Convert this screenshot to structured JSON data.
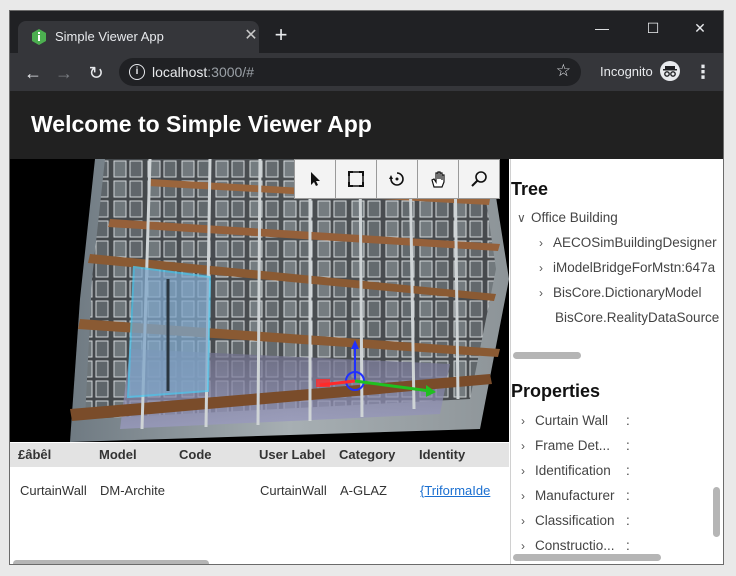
{
  "browser": {
    "tab_title": "Simple Viewer App",
    "url_host": "localhost",
    "url_path": ":3000/#",
    "incognito_label": "Incognito"
  },
  "app": {
    "title": "Welcome to Simple Viewer App"
  },
  "viewport": {
    "tools": [
      "select-icon",
      "fit-view-icon",
      "rotate-icon",
      "pan-icon",
      "zoom-icon"
    ]
  },
  "tree": {
    "heading": "Tree",
    "root": "Office Building",
    "children": [
      "AECOSimBuildingDesigner",
      "iModelBridgeForMstn:647a",
      "BisCore.DictionaryModel",
      "BisCore.RealityDataSource"
    ]
  },
  "properties": {
    "heading": "Properties",
    "categories": [
      "Curtain Wall",
      "Frame Det...",
      "Identification",
      "Manufacturer",
      "Classification",
      "Constructio..."
    ]
  },
  "grid": {
    "columns": [
      "£âbêl",
      "Model",
      "Code",
      "User Label",
      "Category",
      "Identity"
    ],
    "row": [
      "CurtainWall",
      "DM-Archite",
      "",
      "CurtainWall",
      "A-GLAZ",
      "{TriformaIde"
    ]
  },
  "colors": {
    "header_bg": "#212121",
    "chrome_dark": "#202124",
    "link": "#1a6fd1"
  }
}
